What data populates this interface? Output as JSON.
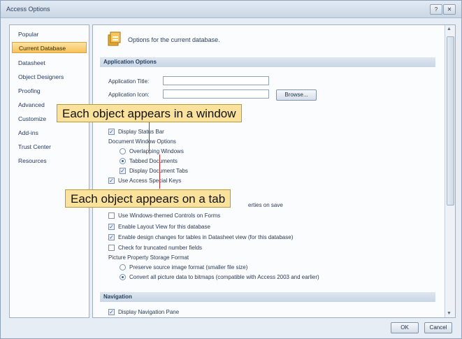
{
  "window": {
    "title": "Access Options",
    "help_glyph": "?",
    "close_glyph": "✕"
  },
  "sidebar": {
    "items": [
      {
        "label": "Popular"
      },
      {
        "label": "Current Database"
      },
      {
        "label": "Datasheet"
      },
      {
        "label": "Object Designers"
      },
      {
        "label": "Proofing"
      },
      {
        "label": "Advanced"
      },
      {
        "label": "Customize"
      },
      {
        "label": "Add-ins"
      },
      {
        "label": "Trust Center"
      },
      {
        "label": "Resources"
      }
    ],
    "selected": "Current Database"
  },
  "main": {
    "header_text": "Options for the current database.",
    "sections": {
      "application_options": "Application Options",
      "navigation": "Navigation"
    },
    "app_title_label": "Application Title:",
    "app_title_value": "",
    "app_icon_label": "Application Icon:",
    "app_icon_value": "",
    "browse_label": "Browse...",
    "display_status_bar": "Display Status Bar",
    "doc_window_options": "Document Window Options",
    "overlapping_windows": "Overlapping Windows",
    "tabbed_documents": "Tabbed Documents",
    "display_document_tabs": "Display Document Tabs",
    "use_special_keys": "Use Access Special Keys",
    "compact_on_close_tail": "erties on save",
    "themed_controls": "Use Windows-themed Controls on Forms",
    "layout_view": "Enable Layout View for this database",
    "design_changes": "Enable design changes for tables in Datasheet view (for this database)",
    "truncated_fields": "Check for truncated number fields",
    "picture_storage": "Picture Property Storage Format",
    "preserve_format": "Preserve source image format (smaller file size)",
    "convert_bitmaps": "Convert all picture data to bitmaps (compatible with Access 2003 and earlier)",
    "display_nav_pane": "Display Navigation Pane"
  },
  "checks": {
    "display_status_bar": true,
    "display_document_tabs": true,
    "use_special_keys": true,
    "themed_controls": false,
    "layout_view": true,
    "design_changes": true,
    "truncated_fields": false,
    "display_nav_pane": true,
    "doc_window_mode": "Tabbed Documents",
    "picture_format": "Convert all picture data to bitmaps"
  },
  "callouts": {
    "window": "Each object appears in a window",
    "tab": "Each object appears on a tab"
  },
  "footer": {
    "ok_label": "OK",
    "cancel_label": "Cancel"
  },
  "colors": {
    "callout_fill": "#fbe29c",
    "pointer": "#c0282a",
    "selected_nav": "#f6c35b"
  }
}
